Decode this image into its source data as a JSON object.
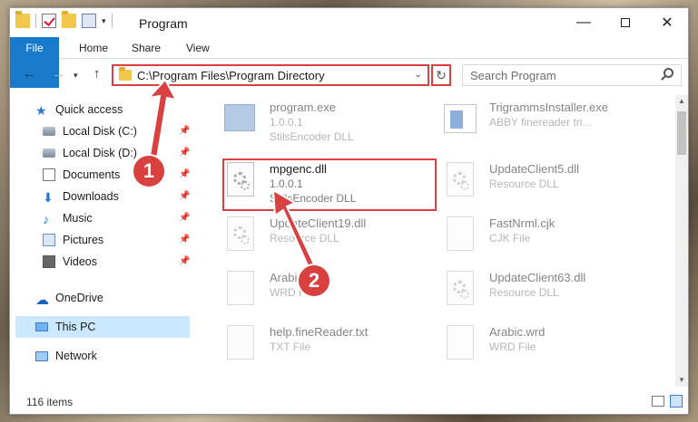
{
  "window": {
    "title": "Program",
    "controls": {
      "minimize": "—",
      "maximize": "",
      "close": "✕"
    }
  },
  "ribbon": {
    "tabs": [
      "File",
      "Home",
      "Share",
      "View"
    ]
  },
  "address": {
    "path": "C:\\Program Files\\Program Directory",
    "search_placeholder": "Search Program"
  },
  "nav": {
    "items": [
      {
        "label": "Quick access",
        "icon": "star-icon"
      },
      {
        "label": "Local Disk (C:)",
        "icon": "drive-icon",
        "pinned": true
      },
      {
        "label": "Local Disk (D:)",
        "icon": "drive-icon",
        "pinned": true
      },
      {
        "label": "Documents",
        "icon": "document-icon",
        "pinned": true
      },
      {
        "label": "Downloads",
        "icon": "download-icon",
        "pinned": true
      },
      {
        "label": "Music",
        "icon": "music-icon",
        "pinned": true
      },
      {
        "label": "Pictures",
        "icon": "pictures-icon",
        "pinned": true
      },
      {
        "label": "Videos",
        "icon": "videos-icon",
        "pinned": true
      },
      {
        "label": "OneDrive",
        "icon": "cloud-icon"
      },
      {
        "label": "This PC",
        "icon": "computer-icon",
        "selected": true
      },
      {
        "label": "Network",
        "icon": "network-icon"
      }
    ]
  },
  "files": [
    {
      "name": "program.exe",
      "line2": "1.0.0.1",
      "line3": "StilsEncoder DLL",
      "icon": "exe-icon"
    },
    {
      "name": "TrigrammsInstaller.exe",
      "line2": "ABBY finereader tri...",
      "line3": "",
      "icon": "installer-icon"
    },
    {
      "name": "mpgenc.dll",
      "line2": "1.0.0.1",
      "line3": "StillsEncoder DLL",
      "icon": "dll-icon",
      "highlighted": true
    },
    {
      "name": "UpdateClient5.dll",
      "line2": "Resource DLL",
      "line3": "",
      "icon": "dll-icon"
    },
    {
      "name": "UpdateClient19.dll",
      "line2": "Resource DLL",
      "line3": "",
      "icon": "dll-icon"
    },
    {
      "name": "FastNrml.cjk",
      "line2": "CJK File",
      "line3": "",
      "icon": "file-icon"
    },
    {
      "name": "Arabic",
      "line2": "WRD F",
      "line3": "",
      "icon": "file-icon"
    },
    {
      "name": "UpdateClient63.dll",
      "line2": "Resource DLL",
      "line3": "",
      "icon": "dll-icon"
    },
    {
      "name": "help.fineReader.txt",
      "line2": "TXT File",
      "line3": "",
      "icon": "file-icon"
    },
    {
      "name": "Arabic.wrd",
      "line2": "WRD File",
      "line3": "",
      "icon": "file-icon"
    }
  ],
  "status": {
    "count": "116 items"
  },
  "annotations": {
    "step1": "1",
    "step2": "2",
    "color": "#d94040"
  }
}
